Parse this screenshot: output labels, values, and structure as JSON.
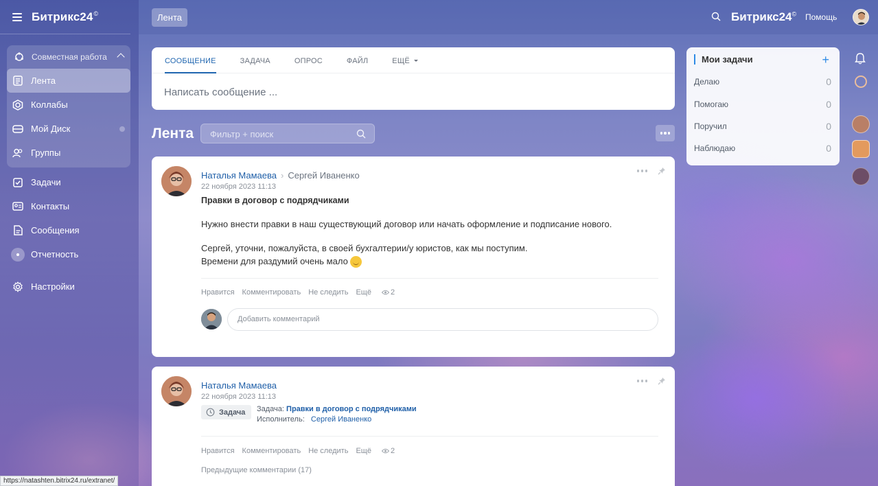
{
  "sidebar": {
    "brand": "Битрикс24",
    "brand_mark": "©",
    "group_label": "Совместная работа",
    "group_items": [
      {
        "label": "Лента",
        "icon": "feed-icon"
      },
      {
        "label": "Коллабы",
        "icon": "collab-icon"
      },
      {
        "label": "Мой Диск",
        "icon": "disk-icon"
      },
      {
        "label": "Группы",
        "icon": "groups-icon"
      }
    ],
    "items": [
      {
        "label": "Задачи",
        "icon": "tasks-icon"
      },
      {
        "label": "Контакты",
        "icon": "contacts-icon"
      },
      {
        "label": "Сообщения",
        "icon": "messages-icon"
      },
      {
        "label": "Отчетность",
        "icon": "reports-icon"
      }
    ],
    "settings_label": "Настройки"
  },
  "header": {
    "chip": "Лента",
    "brand": "Битрикс24",
    "brand_mark": "©",
    "help": "Помощь"
  },
  "composer": {
    "tabs": [
      "СООБЩЕНИЕ",
      "ЗАДАЧА",
      "ОПРОС",
      "ФАЙЛ",
      "ЕЩЁ"
    ],
    "placeholder": "Написать сообщение ..."
  },
  "feed": {
    "title": "Лента",
    "filter_placeholder": "Фильтр + поиск"
  },
  "posts": [
    {
      "author": "Наталья Мамаева",
      "recipient": "Сергей Иваненко",
      "date": "22 ноября 2023 11:13",
      "title": "Правки в договор с подрядчиками",
      "paragraph1": "Нужно внести правки в наш существующий договор или начать оформление и подписание нового.",
      "paragraph2_line1": "Сергей, уточни, пожалуйста, в своей бухгалтерии/у юристов, как мы поступим.",
      "paragraph2_line2": "Времени для раздумий очень мало",
      "actions": [
        "Нравится",
        "Комментировать",
        "Не следить",
        "Ещё"
      ],
      "views": "2",
      "comment_placeholder": "Добавить комментарий"
    },
    {
      "author": "Наталья Мамаева",
      "date": "22 ноября 2023 11:13",
      "badge": "Задача",
      "task_label": "Задача:",
      "task_name": "Правки в договор с подрядчиками",
      "assignee_label": "Исполнитель:",
      "assignee": "Сергей Иваненко",
      "actions": [
        "Нравится",
        "Комментировать",
        "Не следить",
        "Ещё"
      ],
      "views": "2",
      "prev_comments": "Предыдущие комментарии (17)"
    }
  ],
  "tasks_widget": {
    "title": "Мои задачи",
    "add": "+",
    "rows": [
      {
        "label": "Делаю",
        "count": "0"
      },
      {
        "label": "Помогаю",
        "count": "0"
      },
      {
        "label": "Поручил",
        "count": "0"
      },
      {
        "label": "Наблюдаю",
        "count": "0"
      }
    ]
  },
  "statusbar": {
    "url": "https://natashten.bitrix24.ru/extranet/"
  },
  "colors": {
    "link": "#1f5fa8",
    "accent": "#2066b0",
    "tasks_accent": "#2f8be6"
  }
}
